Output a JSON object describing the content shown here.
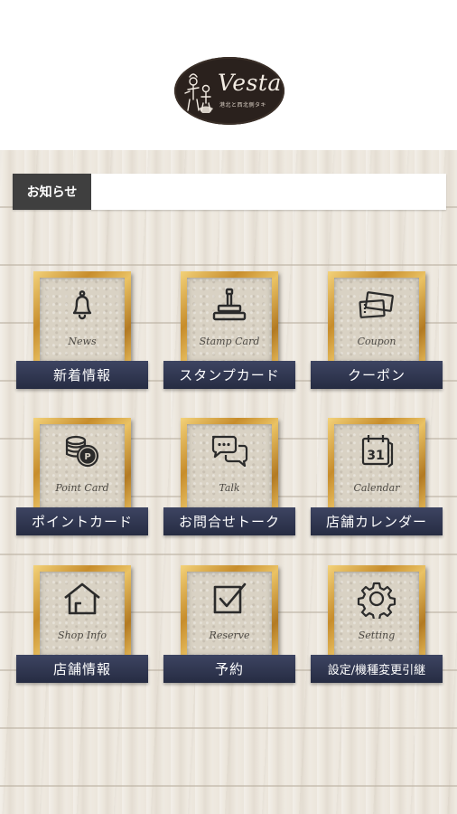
{
  "brand": {
    "name": "Vesta",
    "tagline": "港北と西北側タキ"
  },
  "notice": {
    "label": "お知らせ",
    "text": ""
  },
  "menu": [
    {
      "name": "news",
      "icon": "bell-icon",
      "script": "News",
      "label": "新着情報"
    },
    {
      "name": "stamp-card",
      "icon": "stamp-icon",
      "script": "Stamp Card",
      "label": "スタンプカード"
    },
    {
      "name": "coupon",
      "icon": "coupon-icon",
      "script": "Coupon",
      "label": "クーポン"
    },
    {
      "name": "point-card",
      "icon": "coins-icon",
      "script": "Point Card",
      "label": "ポイントカード"
    },
    {
      "name": "talk",
      "icon": "chat-icon",
      "script": "Talk",
      "label": "お問合せトーク"
    },
    {
      "name": "calendar",
      "icon": "calendar-icon",
      "script": "Calendar",
      "label": "店舗カレンダー"
    },
    {
      "name": "shop-info",
      "icon": "house-icon",
      "script": "Shop Info",
      "label": "店舗情報"
    },
    {
      "name": "reserve",
      "icon": "checkbox-icon",
      "script": "Reserve",
      "label": "予約"
    },
    {
      "name": "setting",
      "icon": "gear-icon",
      "script": "Setting",
      "label": "設定/機種変更引継"
    }
  ],
  "calendar_day": "31",
  "colors": {
    "label_bg": "#2f3550",
    "frame_gold": "#d6a445",
    "notice_label_bg": "#3f3f3f"
  }
}
